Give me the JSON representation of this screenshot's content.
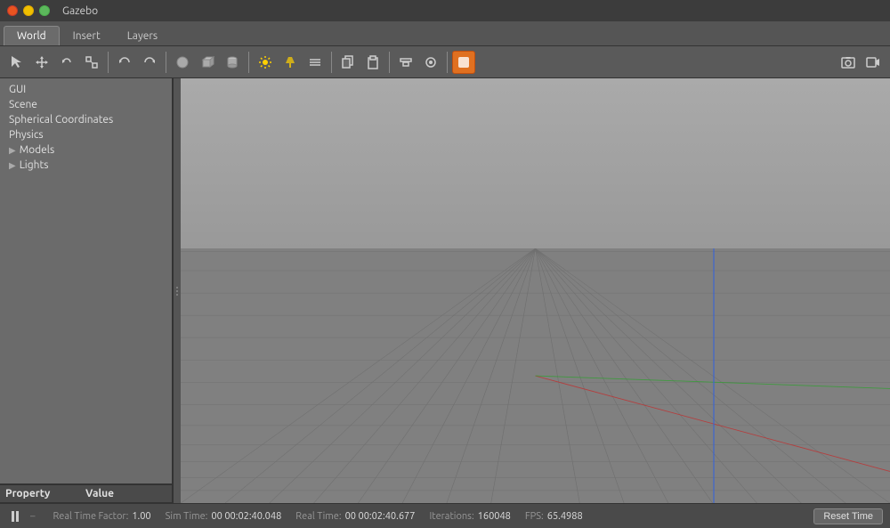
{
  "titlebar": {
    "title": "Gazebo"
  },
  "tabs": [
    {
      "id": "world",
      "label": "World",
      "active": true
    },
    {
      "id": "insert",
      "label": "Insert",
      "active": false
    },
    {
      "id": "layers",
      "label": "Layers",
      "active": false
    }
  ],
  "toolbar": {
    "buttons": [
      {
        "id": "select",
        "icon": "↖",
        "title": "Select Mode"
      },
      {
        "id": "translate",
        "icon": "✛",
        "title": "Translate Mode"
      },
      {
        "id": "rotate",
        "icon": "↻",
        "title": "Rotate Mode"
      },
      {
        "id": "scale",
        "icon": "⤢",
        "title": "Scale Mode"
      },
      {
        "id": "undo",
        "icon": "←",
        "title": "Undo"
      },
      {
        "id": "redo",
        "icon": "→",
        "title": "Redo"
      },
      {
        "id": "sphere",
        "icon": "●",
        "title": "Sphere"
      },
      {
        "id": "box",
        "icon": "■",
        "title": "Box"
      },
      {
        "id": "cylinder",
        "icon": "⬡",
        "title": "Cylinder"
      },
      {
        "id": "sun",
        "icon": "☀",
        "title": "Point Light"
      },
      {
        "id": "spot",
        "icon": "✦",
        "title": "Spot Light"
      },
      {
        "id": "dir",
        "icon": "≋",
        "title": "Directional Light"
      },
      {
        "id": "copy",
        "icon": "❐",
        "title": "Copy"
      },
      {
        "id": "paste",
        "icon": "📋",
        "title": "Paste"
      },
      {
        "id": "align",
        "icon": "⊞",
        "title": "Align"
      },
      {
        "id": "snap",
        "icon": "⌘",
        "title": "Snap"
      },
      {
        "id": "orange",
        "icon": "■",
        "title": "Toggle",
        "active": true
      }
    ]
  },
  "world_tree": {
    "items": [
      {
        "id": "gui",
        "label": "GUI",
        "indent": 0,
        "has_arrow": false
      },
      {
        "id": "scene",
        "label": "Scene",
        "indent": 0,
        "has_arrow": false
      },
      {
        "id": "spherical_coordinates",
        "label": "Spherical Coordinates",
        "indent": 0,
        "has_arrow": false
      },
      {
        "id": "physics",
        "label": "Physics",
        "indent": 0,
        "has_arrow": false
      },
      {
        "id": "models",
        "label": "Models",
        "indent": 0,
        "has_arrow": true
      },
      {
        "id": "lights",
        "label": "Lights",
        "indent": 0,
        "has_arrow": true
      }
    ]
  },
  "property_table": {
    "col_property": "Property",
    "col_value": "Value"
  },
  "statusbar": {
    "real_time_factor_label": "Real Time Factor:",
    "real_time_factor_value": "1.00",
    "sim_time_label": "Sim Time:",
    "sim_time_value": "00 00:02:40.048",
    "real_time_label": "Real Time:",
    "real_time_value": "00 00:02:40.677",
    "iterations_label": "Iterations:",
    "iterations_value": "160048",
    "fps_label": "FPS:",
    "fps_value": "65.4988",
    "reset_button_label": "Reset Time"
  },
  "colors": {
    "accent_orange": "#e07020",
    "blue_line": "#3060e0",
    "grid_line": "#707070",
    "axis_red": "#c03030",
    "axis_green": "#30a030",
    "axis_blue": "#3060e0"
  }
}
